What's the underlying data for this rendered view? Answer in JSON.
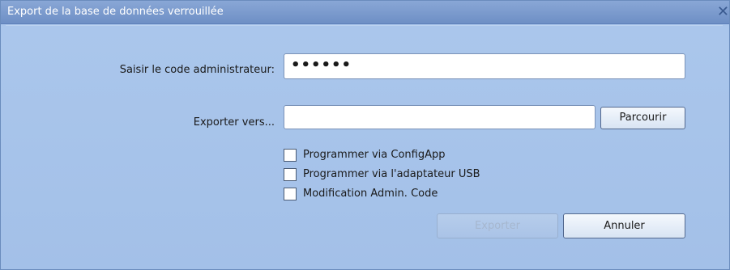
{
  "window": {
    "title": "Export de la base de données verrouillée",
    "close_glyph": "✕"
  },
  "admin_code": {
    "label": "Saisir le code administrateur:",
    "value": "••••••"
  },
  "export_to": {
    "label": "Exporter vers...",
    "value": "",
    "browse_label": "Parcourir"
  },
  "options": [
    {
      "label": "Programmer via ConfigApp",
      "checked": false
    },
    {
      "label": "Programmer via l'adaptateur USB",
      "checked": false
    },
    {
      "label": "Modification Admin. Code",
      "checked": false
    }
  ],
  "actions": {
    "export_label": "Exporter",
    "export_enabled": false,
    "cancel_label": "Annuler"
  },
  "colors": {
    "background": "#a3c0e8",
    "titlebar": "#6e8fc5",
    "title_text": "#ffffff"
  }
}
